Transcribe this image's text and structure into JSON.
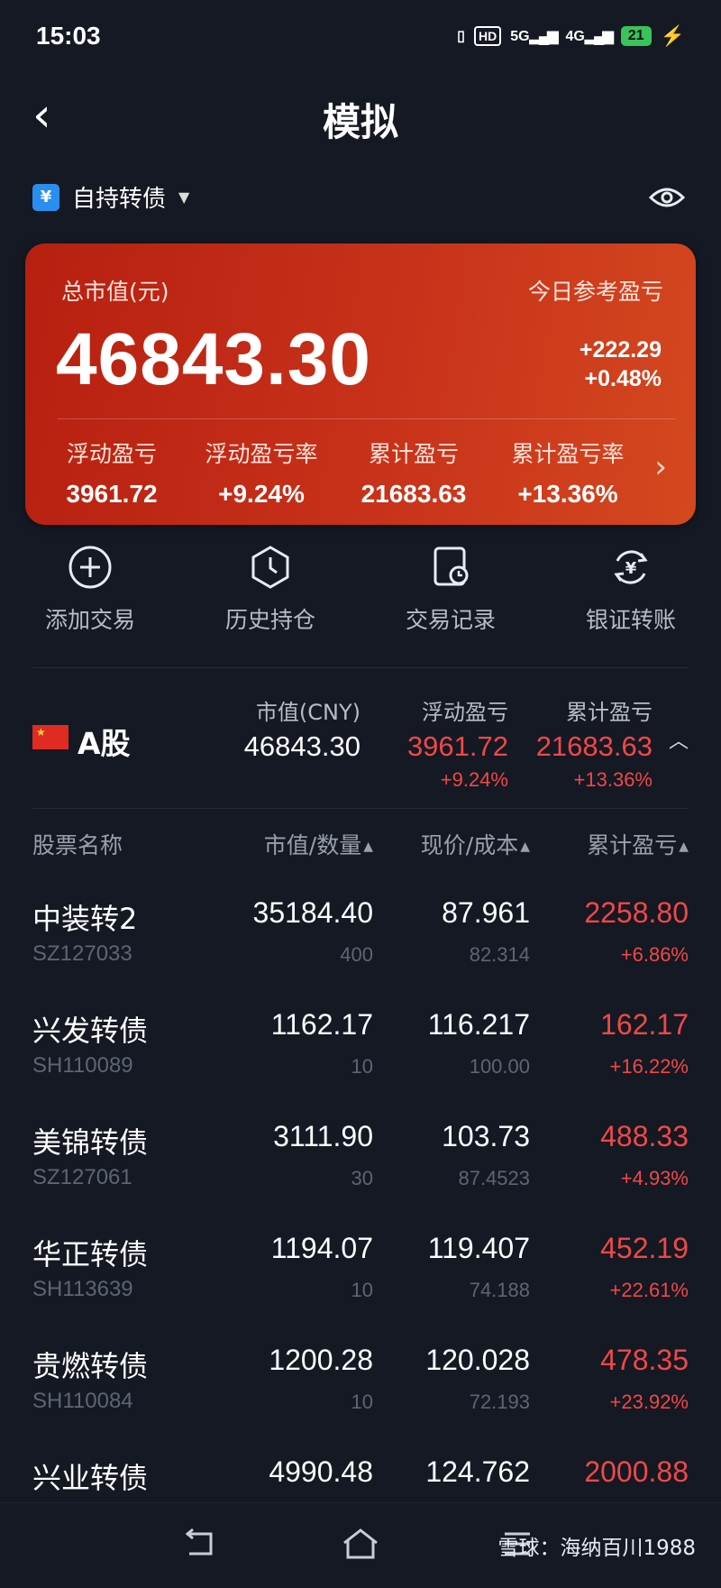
{
  "status_bar": {
    "time": "15:03",
    "hd": "HD",
    "net1": "5G",
    "net2": "4G",
    "battery": "21"
  },
  "header": {
    "title": "模拟",
    "back_icon": "chevron-left-icon"
  },
  "account": {
    "name": "自持转债",
    "icon_glyph": "¥"
  },
  "summary": {
    "total_label": "总市值(元)",
    "total_value": "46843.30",
    "today_label": "今日参考盈亏",
    "today_value": "+222.29",
    "today_pct": "+0.48%",
    "stats": [
      {
        "label": "浮动盈亏",
        "value": "3961.72"
      },
      {
        "label": "浮动盈亏率",
        "value": "+9.24%"
      },
      {
        "label": "累计盈亏",
        "value": "21683.63"
      },
      {
        "label": "累计盈亏率",
        "value": "+13.36%"
      }
    ]
  },
  "actions": [
    {
      "label": "添加交易",
      "icon": "plus-circle-icon"
    },
    {
      "label": "历史持仓",
      "icon": "clock-icon"
    },
    {
      "label": "交易记录",
      "icon": "record-icon"
    },
    {
      "label": "银证转账",
      "icon": "transfer-icon"
    }
  ],
  "market": {
    "name": "A股",
    "h1": "市值(CNY)",
    "v1": "46843.30",
    "h2": "浮动盈亏",
    "v2": "3961.72",
    "p2": "+9.24%",
    "h3": "累计盈亏",
    "v3": "21683.63",
    "p3": "+13.36%"
  },
  "table": {
    "headers": [
      "股票名称",
      "市值/数量",
      "现价/成本",
      "累计盈亏"
    ],
    "rows": [
      {
        "name": "中装转2",
        "code": "SZ127033",
        "mv": "35184.40",
        "qty": "400",
        "price": "87.961",
        "cost": "82.314",
        "pnl": "2258.80",
        "pct": "+6.86%"
      },
      {
        "name": "兴发转债",
        "code": "SH110089",
        "mv": "1162.17",
        "qty": "10",
        "price": "116.217",
        "cost": "100.00",
        "pnl": "162.17",
        "pct": "+16.22%"
      },
      {
        "name": "美锦转债",
        "code": "SZ127061",
        "mv": "3111.90",
        "qty": "30",
        "price": "103.73",
        "cost": "87.4523",
        "pnl": "488.33",
        "pct": "+4.93%"
      },
      {
        "name": "华正转债",
        "code": "SH113639",
        "mv": "1194.07",
        "qty": "10",
        "price": "119.407",
        "cost": "74.188",
        "pnl": "452.19",
        "pct": "+22.61%"
      },
      {
        "name": "贵燃转债",
        "code": "SH110084",
        "mv": "1200.28",
        "qty": "10",
        "price": "120.028",
        "cost": "72.193",
        "pnl": "478.35",
        "pct": "+23.92%"
      },
      {
        "name": "兴业转债",
        "code": "",
        "mv": "4990.48",
        "qty": "",
        "price": "124.762",
        "cost": "",
        "pnl": "2000.88",
        "pct": ""
      }
    ]
  },
  "watermark": "雪球：海纳百川1988",
  "colors": {
    "background": "#141923",
    "card_start": "#b71f10",
    "card_end": "#d4481f",
    "up": "#f04848"
  }
}
